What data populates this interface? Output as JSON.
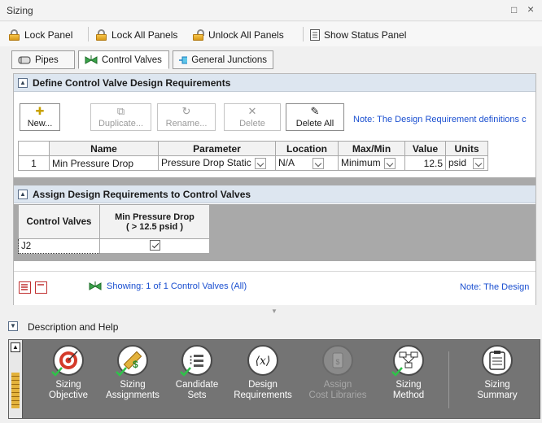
{
  "window": {
    "title": "Sizing",
    "restore_glyph": "□",
    "close_glyph": "×"
  },
  "toolbar": {
    "lock_panel": "Lock Panel",
    "lock_all_panels": "Lock All Panels",
    "unlock_all_panels": "Unlock All Panels",
    "show_status_panel": "Show Status Panel"
  },
  "tabs": [
    {
      "label": "Pipes",
      "icon": "pipe-icon"
    },
    {
      "label": "Control Valves",
      "icon": "control-valve-icon",
      "active": true
    },
    {
      "label": "General Junctions",
      "icon": "junction-icon"
    }
  ],
  "design_requirements": {
    "section_title": "Define Control Valve Design Requirements",
    "buttons": {
      "new": "New...",
      "duplicate": "Duplicate...",
      "rename": "Rename...",
      "delete": "Delete",
      "delete_all": "Delete All"
    },
    "note": "Note: The Design Requirement definitions c",
    "columns": [
      "Name",
      "Parameter",
      "Location",
      "Max/Min",
      "Value",
      "Units"
    ],
    "rows": [
      {
        "num": "1",
        "name": "Min Pressure Drop",
        "parameter": "Pressure Drop Static",
        "location": "N/A",
        "maxmin": "Minimum",
        "value": "12.5",
        "units": "psid"
      }
    ]
  },
  "assign": {
    "section_title": "Assign Design Requirements to Control Valves",
    "col_control_valves": "Control Valves",
    "col_requirement_line1": "Min Pressure Drop",
    "col_requirement_line2": "( > 12.5 psid )",
    "rows": [
      {
        "valve": "J2",
        "checked": true
      }
    ]
  },
  "status": {
    "showing": "Showing: 1 of 1 Control Valves (All)",
    "note": "Note: The Design"
  },
  "description": {
    "label": "Description and Help"
  },
  "bottom_panel": {
    "items": [
      {
        "line1": "Sizing",
        "line2": "Objective",
        "icon": "target-icon",
        "enabled": true
      },
      {
        "line1": "Sizing",
        "line2": "Assignments",
        "icon": "ruler-dollar-icon",
        "enabled": true
      },
      {
        "line1": "Candidate",
        "line2": "Sets",
        "icon": "candidate-sets-icon",
        "enabled": true
      },
      {
        "line1": "Design",
        "line2": "Requirements",
        "icon": "variable-x-icon",
        "enabled": true
      },
      {
        "line1": "Assign",
        "line2": "Cost Libraries",
        "icon": "cost-library-icon",
        "enabled": false
      },
      {
        "line1": "Sizing",
        "line2": "Method",
        "icon": "flowchart-icon",
        "enabled": true
      },
      {
        "line1": "Sizing",
        "line2": "Summary",
        "icon": "summary-clipboard-icon",
        "enabled": true
      }
    ]
  }
}
